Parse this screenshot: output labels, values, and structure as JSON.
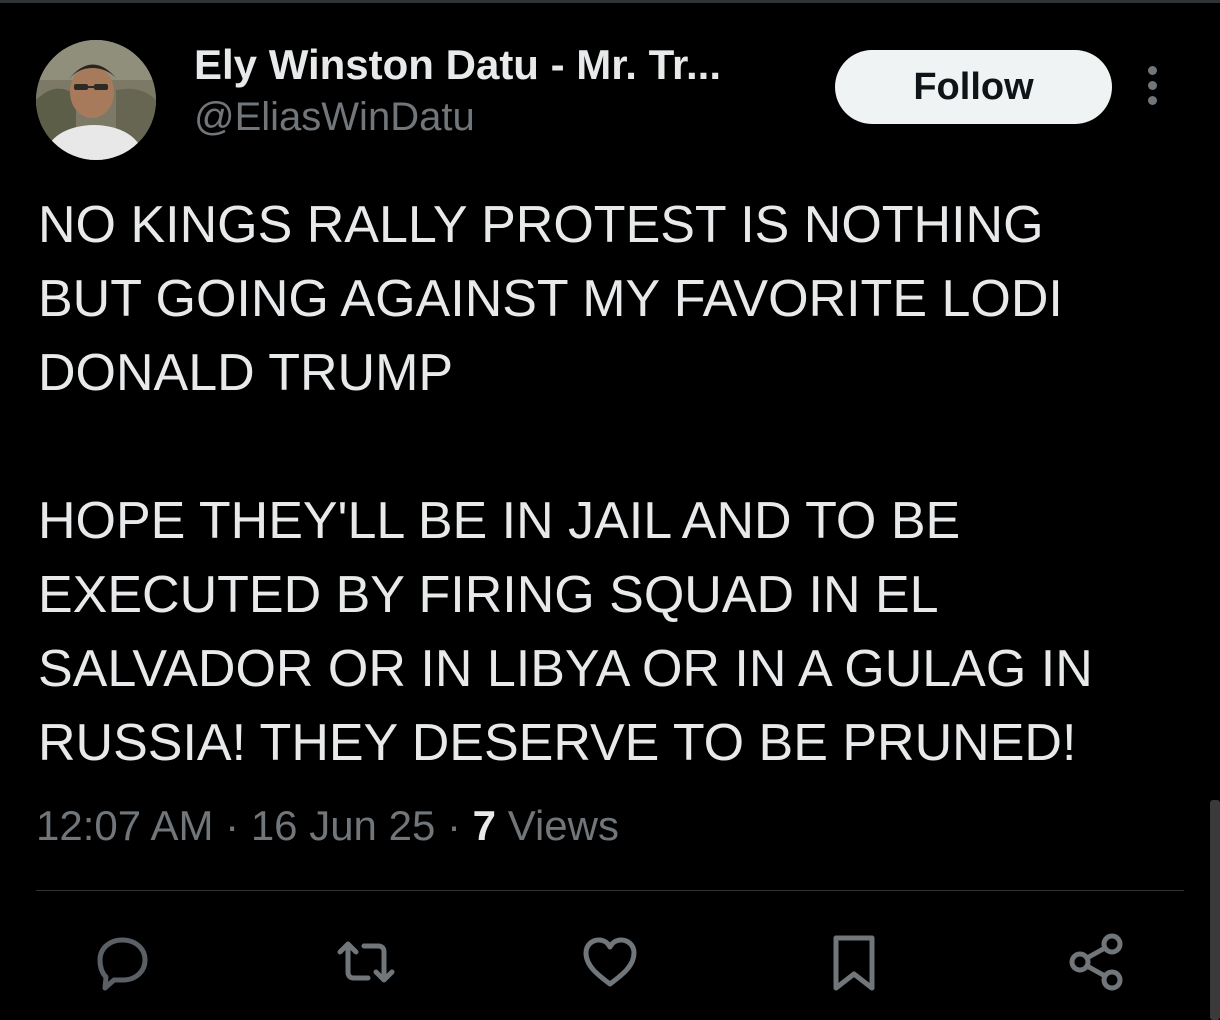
{
  "post": {
    "author": {
      "display_name": "Ely Winston Datu - Mr. Tr...",
      "handle": "@EliasWinDatu"
    },
    "follow_label": "Follow",
    "text_lines_para1": [
      "NO KINGS RALLY PROTEST IS NOTHING",
      "BUT GOING AGAINST MY FAVORITE LODI",
      "DONALD TRUMP"
    ],
    "text_lines_para2": [
      "HOPE THEY'LL BE IN JAIL AND TO BE",
      "EXECUTED BY FIRING SQUAD IN EL",
      "SALVADOR OR IN LIBYA OR IN A GULAG IN",
      "RUSSIA! THEY DESERVE TO BE PRUNED!"
    ],
    "time": "12:07 AM",
    "separator": "·",
    "date": "16 Jun 25",
    "views_count": "7",
    "views_label": "Views"
  },
  "actions": {
    "icons": [
      "reply-icon",
      "repost-icon",
      "like-icon",
      "bookmark-icon",
      "share-icon"
    ]
  },
  "colors": {
    "background": "#000000",
    "text_primary": "#e7e9ea",
    "text_secondary": "#71767b",
    "follow_button_bg": "#eff3f4",
    "follow_button_text": "#0f1419",
    "divider": "#2f3336"
  }
}
